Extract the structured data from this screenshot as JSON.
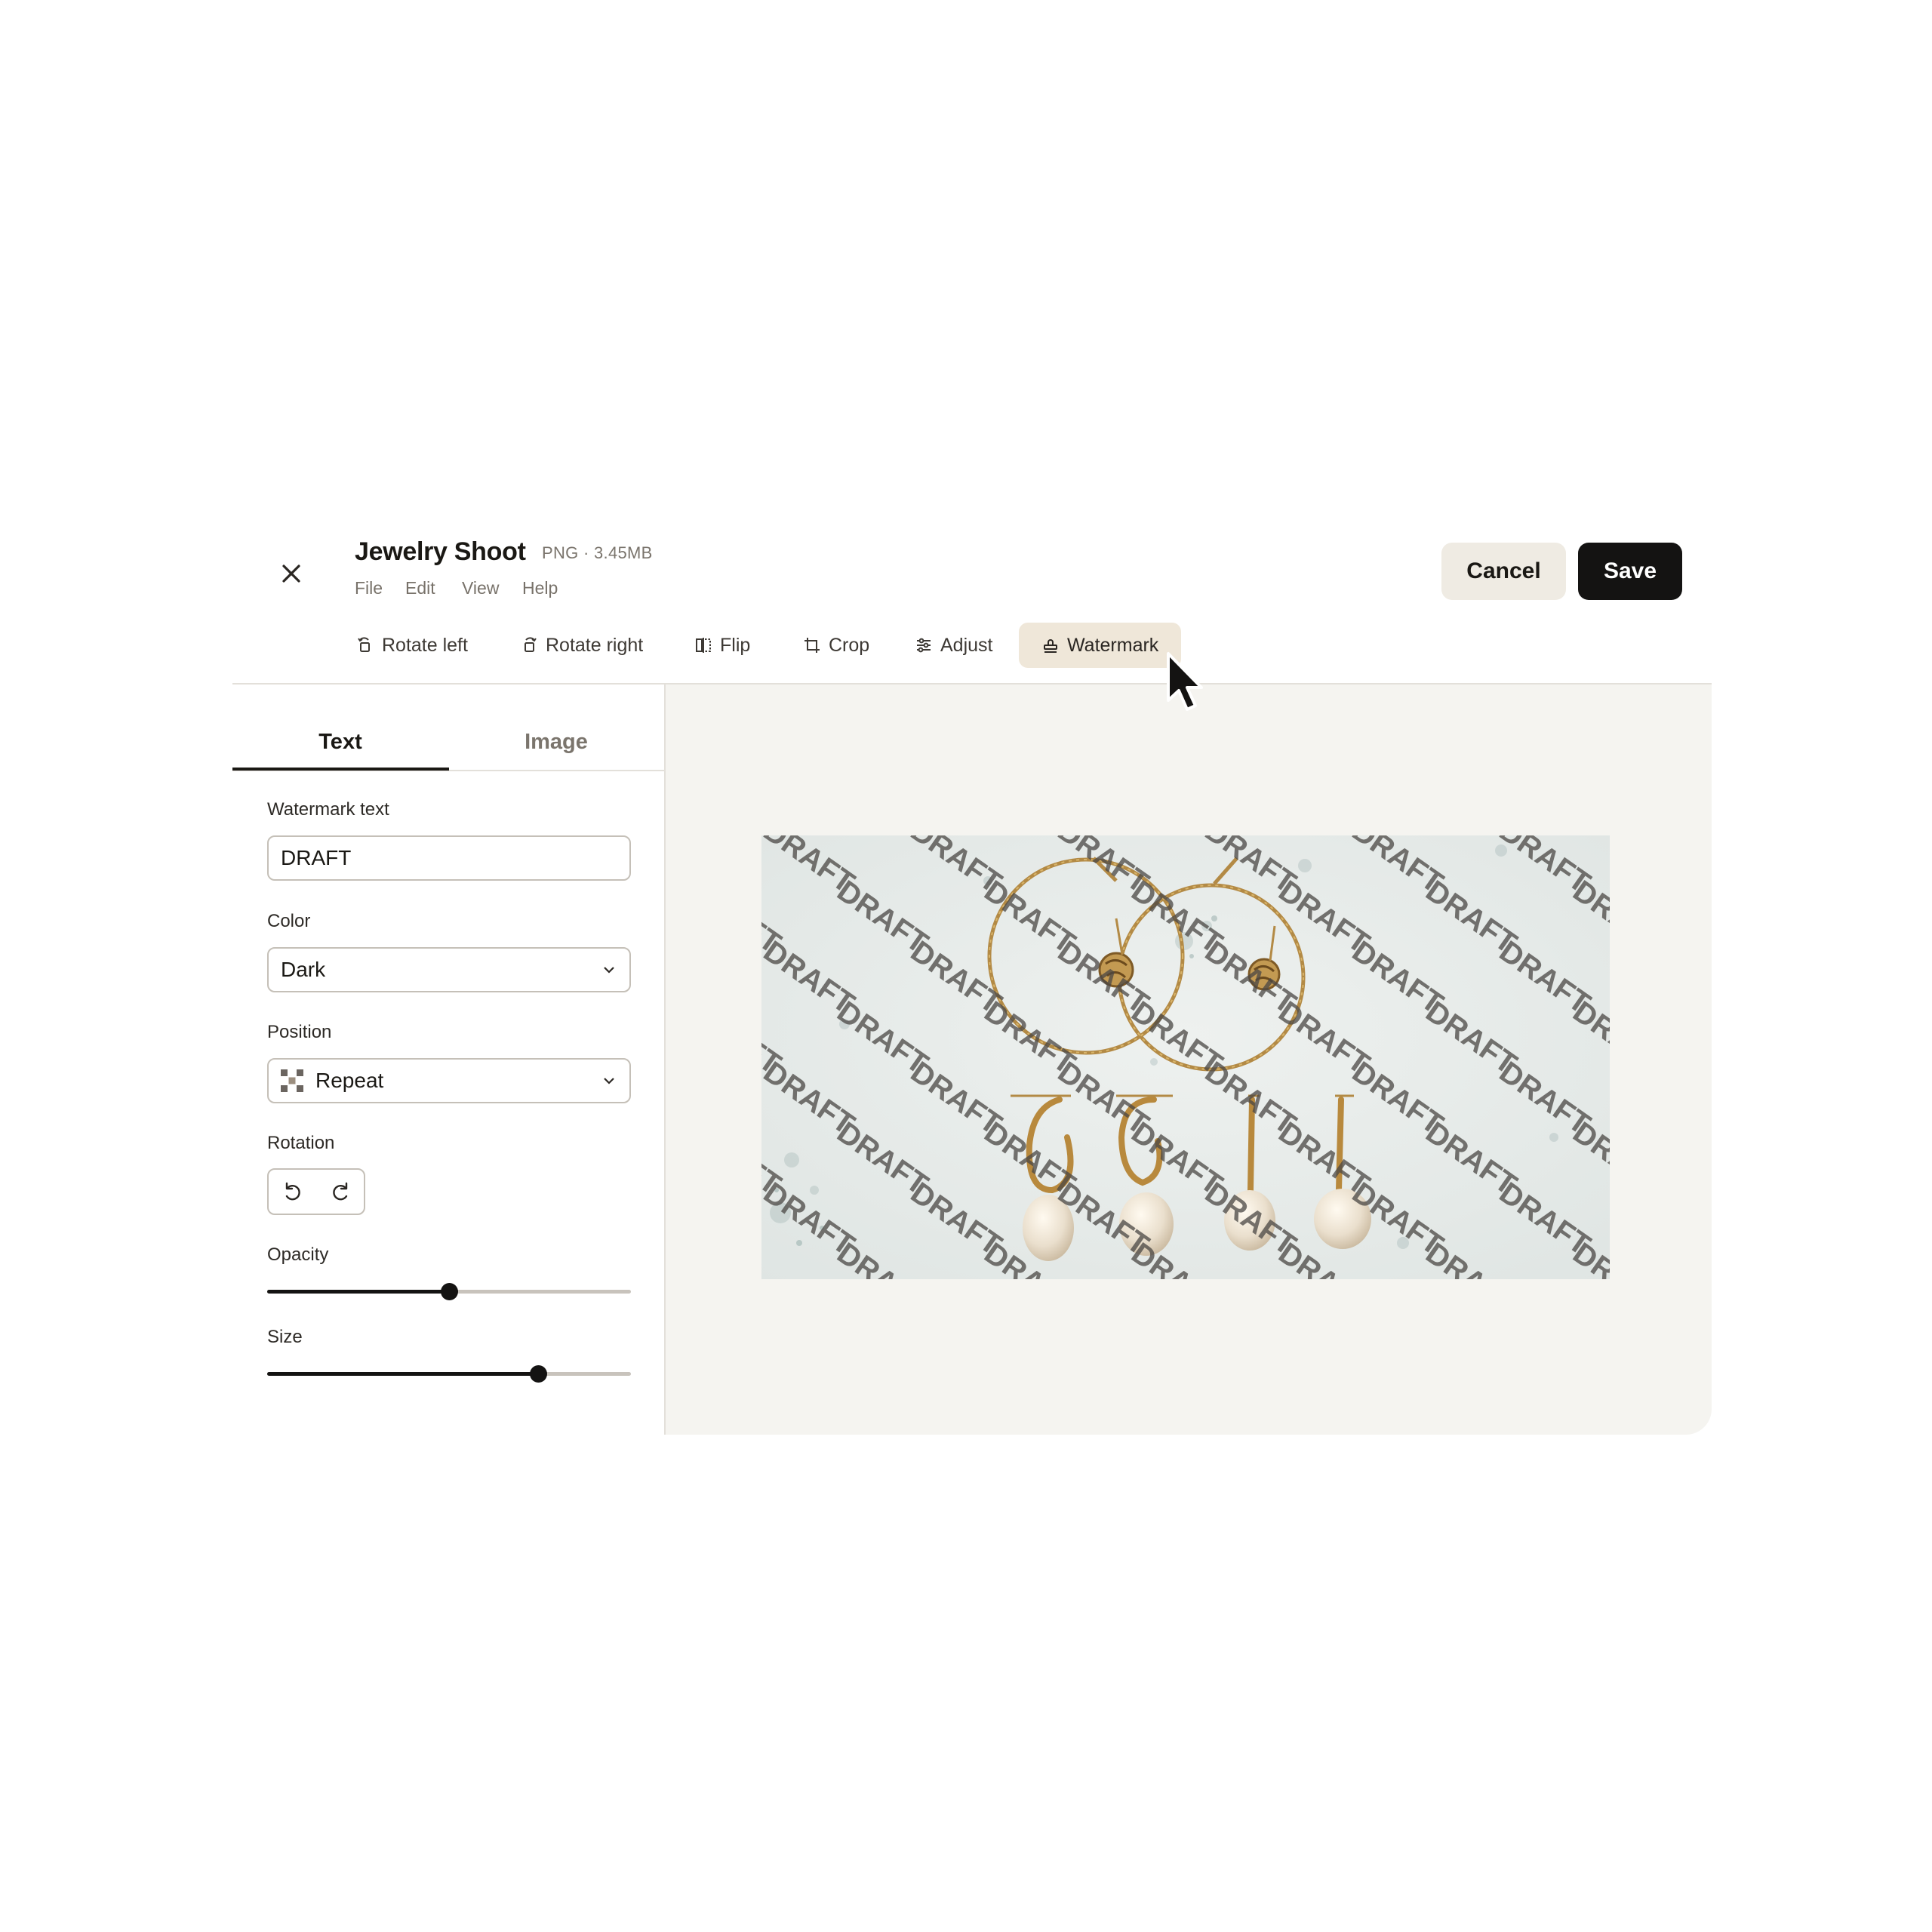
{
  "header": {
    "title": "Jewelry Shoot",
    "meta": "PNG · 3.45MB",
    "menu": [
      "File",
      "Edit",
      "View",
      "Help"
    ],
    "cancel_label": "Cancel",
    "save_label": "Save"
  },
  "toolbar": {
    "tools": [
      {
        "label": "Rotate left",
        "icon": "rotate-left-icon"
      },
      {
        "label": "Rotate right",
        "icon": "rotate-right-icon"
      },
      {
        "label": "Flip",
        "icon": "flip-icon"
      },
      {
        "label": "Crop",
        "icon": "crop-icon"
      },
      {
        "label": "Adjust",
        "icon": "adjust-icon"
      },
      {
        "label": "Watermark",
        "icon": "stamp-icon",
        "active": true
      }
    ]
  },
  "panel": {
    "tabs": [
      {
        "label": "Text",
        "active": true
      },
      {
        "label": "Image",
        "active": false
      }
    ],
    "watermark_text_label": "Watermark text",
    "watermark_text_value": "DRAFT",
    "color_label": "Color",
    "color_value": "Dark",
    "position_label": "Position",
    "position_value": "Repeat",
    "rotation_label": "Rotation",
    "opacity_label": "Opacity",
    "opacity_value": 0.5,
    "size_label": "Size",
    "size_value": 0.745
  },
  "canvas": {
    "watermark_word": "DRAFT",
    "watermark_color": "#4a4744",
    "watermark_angle_deg": 35
  },
  "colors": {
    "accent_active": "#efe7d9",
    "primary": "#141312",
    "cancel_bg": "#efebe3",
    "canvas_bg": "#f5f4f0"
  }
}
